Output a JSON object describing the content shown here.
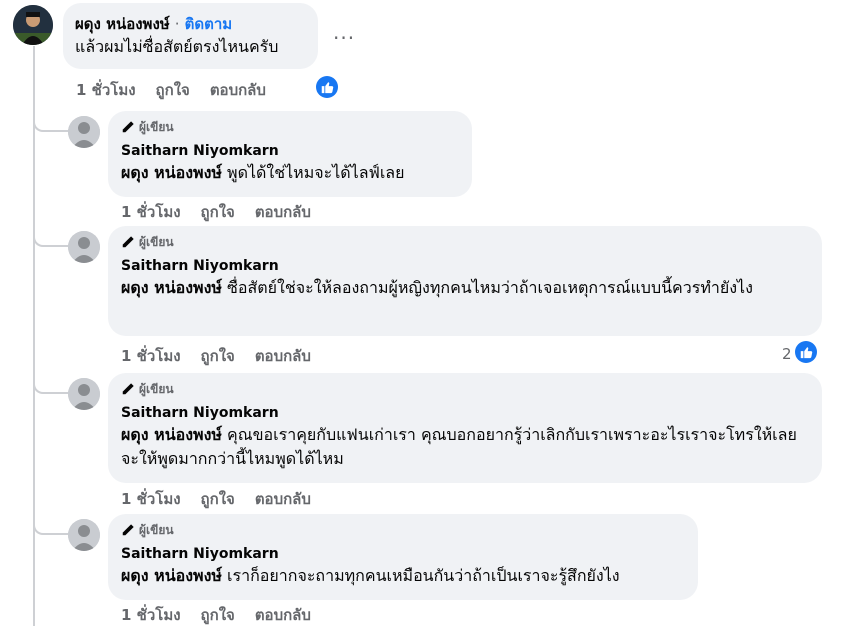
{
  "main_comment": {
    "author": "ผดุง หน่องพงษ์",
    "separator": "·",
    "follow_label": "ติดตาม",
    "text": "แล้วผมไม่ซื่อสัตย์ตรงไหนครับ",
    "time": "1 ชั่วโมง",
    "like_label": "ถูกใจ",
    "reply_label": "ตอบกลับ"
  },
  "replies": [
    {
      "badge": "ผู้เขียน",
      "author": "Saitharn Niyomkarn",
      "mention": "ผดุง หน่องพงษ์",
      "text": " พูดได้ใช่ไหมจะได้ไลฟ์เลย",
      "time": "1 ชั่วโมง",
      "like_label": "ถูกใจ",
      "reply_label": "ตอบกลับ"
    },
    {
      "badge": "ผู้เขียน",
      "author": "Saitharn Niyomkarn",
      "mention": "ผดุง หน่องพงษ์",
      "text": " ซื่อสัตย์ใช่จะให้ลองถามผู้หญิงทุกคนไหมว่าถ้าเจอเหตุการณ์แบบนี้ควรทำยังไง",
      "time": "1 ชั่วโมง",
      "like_label": "ถูกใจ",
      "reply_label": "ตอบกลับ",
      "reaction_count": "2"
    },
    {
      "badge": "ผู้เขียน",
      "author": "Saitharn Niyomkarn",
      "mention": "ผดุง หน่องพงษ์",
      "text": " คุณขอเราคุยกับแฟนเก่าเรา คุณบอกอยากรู้ว่าเลิกกับเราเพราะอะไรเราจะโทรให้เลย จะให้พูดมากกว่านี้ไหมพูดได้ไหม",
      "time": "1 ชั่วโมง",
      "like_label": "ถูกใจ",
      "reply_label": "ตอบกลับ"
    },
    {
      "badge": "ผู้เขียน",
      "author": "Saitharn Niyomkarn",
      "mention": "ผดุง หน่องพงษ์",
      "text": " เราก็อยากจะถามทุกคนเหมือนกันว่าถ้าเป็นเราจะรู้สึกยังไง",
      "time": "1 ชั่วโมง",
      "like_label": "ถูกใจ",
      "reply_label": "ตอบกลับ"
    }
  ],
  "icons": {
    "more": "more-horizontal-icon",
    "like": "like-thumb-icon",
    "author_badge": "pencil-icon"
  },
  "colors": {
    "accent": "#1877f2",
    "bubble": "#f0f2f5",
    "secondary_text": "#65676b"
  }
}
